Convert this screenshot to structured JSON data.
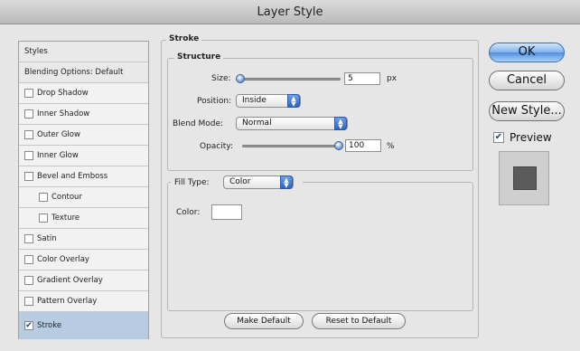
{
  "window": {
    "title": "Layer Style"
  },
  "sidebar": {
    "items": [
      {
        "label": "Styles",
        "type": "header"
      },
      {
        "label": "Blending Options: Default",
        "type": "header"
      },
      {
        "label": "Drop Shadow",
        "checked": false
      },
      {
        "label": "Inner Shadow",
        "checked": false
      },
      {
        "label": "Outer Glow",
        "checked": false
      },
      {
        "label": "Inner Glow",
        "checked": false
      },
      {
        "label": "Bevel and Emboss",
        "checked": false
      },
      {
        "label": "Contour",
        "checked": false,
        "indent": true
      },
      {
        "label": "Texture",
        "checked": false,
        "indent": true
      },
      {
        "label": "Satin",
        "checked": false
      },
      {
        "label": "Color Overlay",
        "checked": false
      },
      {
        "label": "Gradient Overlay",
        "checked": false
      },
      {
        "label": "Pattern Overlay",
        "checked": false
      },
      {
        "label": "Stroke",
        "checked": true,
        "selected": true
      }
    ]
  },
  "stroke": {
    "title": "Stroke",
    "structure": {
      "title": "Structure",
      "size_label": "Size:",
      "size_value": "5",
      "size_unit": "px",
      "size_slider_fraction": 0.02,
      "position_label": "Position:",
      "position_value": "Inside",
      "blend_label": "Blend Mode:",
      "blend_value": "Normal",
      "opacity_label": "Opacity:",
      "opacity_value": "100",
      "opacity_unit": "%",
      "opacity_slider_fraction": 1.0
    },
    "fill": {
      "type_label": "Fill Type:",
      "type_value": "Color",
      "color_label": "Color:",
      "color_value": "#ffffff"
    },
    "make_default_label": "Make Default",
    "reset_default_label": "Reset to Default"
  },
  "actions": {
    "ok_label": "OK",
    "cancel_label": "Cancel",
    "new_style_label": "New Style...",
    "preview_label": "Preview",
    "preview_checked": true,
    "preview_swatch_color": "#5b5b5b"
  },
  "colors": {
    "selection": "#b7cbe3",
    "accent": "#3f6fb8"
  }
}
